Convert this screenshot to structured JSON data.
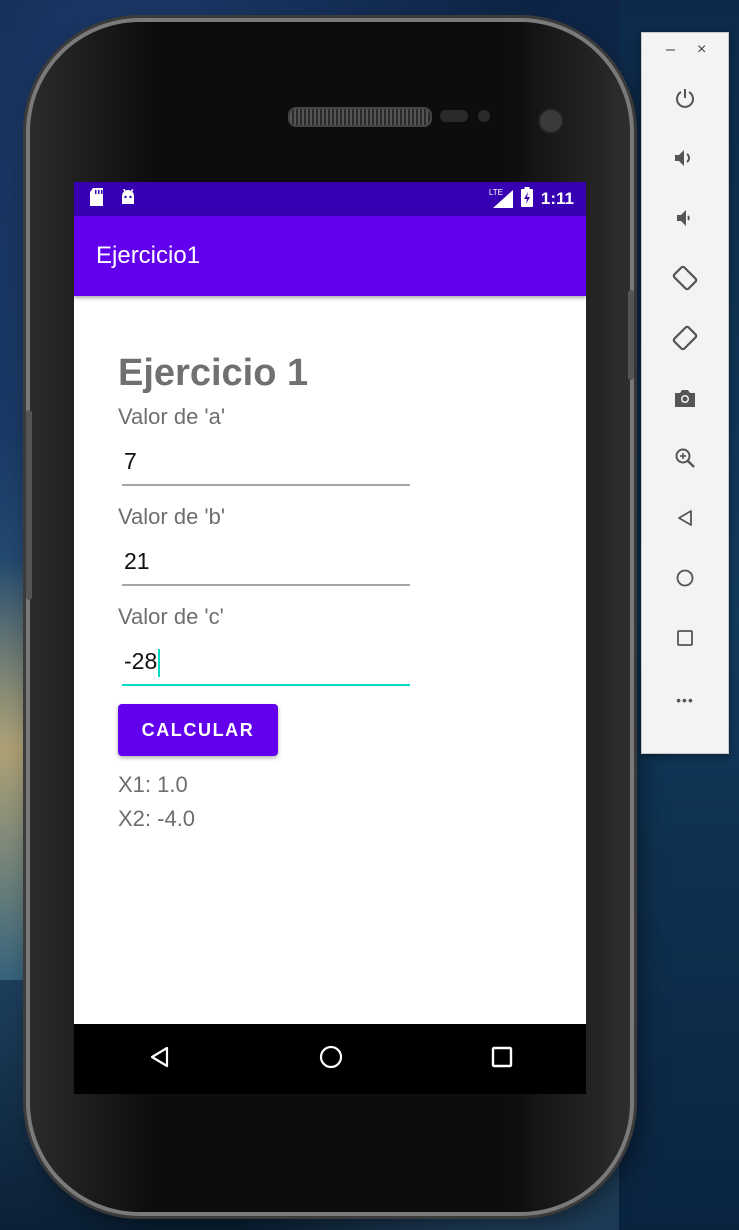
{
  "status_bar": {
    "time": "1:11",
    "network_label": "LTE",
    "icons": [
      "sd-card-icon",
      "android-icon",
      "lte-signal-icon",
      "battery-charging-icon"
    ]
  },
  "app_bar": {
    "title": "Ejercicio1"
  },
  "form": {
    "heading": "Ejercicio 1",
    "a_label": "Valor de 'a'",
    "a_value": "7",
    "b_label": "Valor de 'b'",
    "b_value": "21",
    "c_label": "Valor de 'c'",
    "c_value": "-28",
    "calculate_button": "CALCULAR",
    "result_x1": "X1: 1.0",
    "result_x2": "X2: -4.0"
  },
  "nav_bar": {
    "icons": [
      "back-icon",
      "home-icon",
      "recents-icon"
    ]
  },
  "emulator_panel": {
    "minimize": "–",
    "close": "×",
    "more": "•••",
    "tools": [
      "power-icon",
      "volume-up-icon",
      "volume-down-icon",
      "rotate-left-icon",
      "rotate-right-icon",
      "camera-icon",
      "zoom-icon",
      "back-icon",
      "home-icon",
      "overview-icon",
      "more-icon"
    ]
  },
  "colors": {
    "primary": "#6200ee",
    "primary_dark": "#3700b3",
    "accent": "#03dac5"
  }
}
